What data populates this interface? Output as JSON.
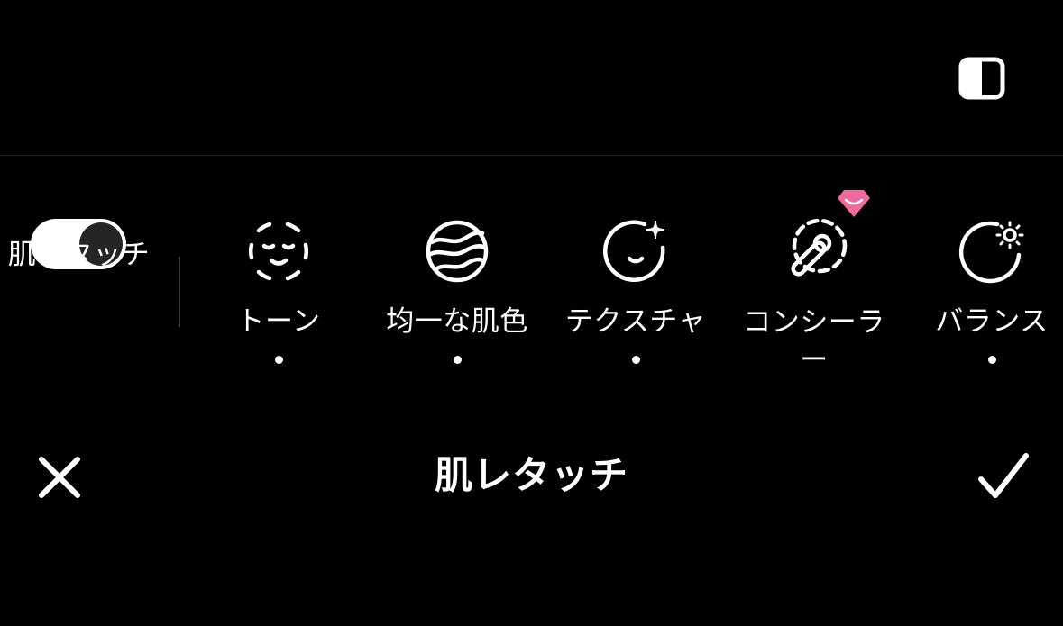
{
  "top_bar": {
    "compare_icon": "split-compare-icon"
  },
  "skin_retouch_toggle": {
    "label": "肌レタッチ",
    "state": "on"
  },
  "tools": [
    {
      "id": "tone",
      "label": "トーン",
      "icon": "face-smile-icon",
      "has_dot": true,
      "premium": false
    },
    {
      "id": "even-skin",
      "label": "均一な肌色",
      "icon": "striped-sphere-icon",
      "has_dot": true,
      "premium": false
    },
    {
      "id": "texture",
      "label": "テクスチャ",
      "icon": "face-sparkle-icon",
      "has_dot": true,
      "premium": false
    },
    {
      "id": "concealer",
      "label": "コンシーラー",
      "icon": "concealer-wand-icon",
      "has_dot": false,
      "premium": true
    },
    {
      "id": "balance",
      "label": "バランス",
      "icon": "face-sun-icon",
      "has_dot": true,
      "premium": false
    }
  ],
  "bottom_bar": {
    "title": "肌レタッチ",
    "close_icon": "close-icon",
    "confirm_icon": "checkmark-icon"
  },
  "colors": {
    "background": "#000000",
    "foreground": "#ffffff",
    "premium_pink": "#f06aa0",
    "toggle_knob": "#252527"
  }
}
